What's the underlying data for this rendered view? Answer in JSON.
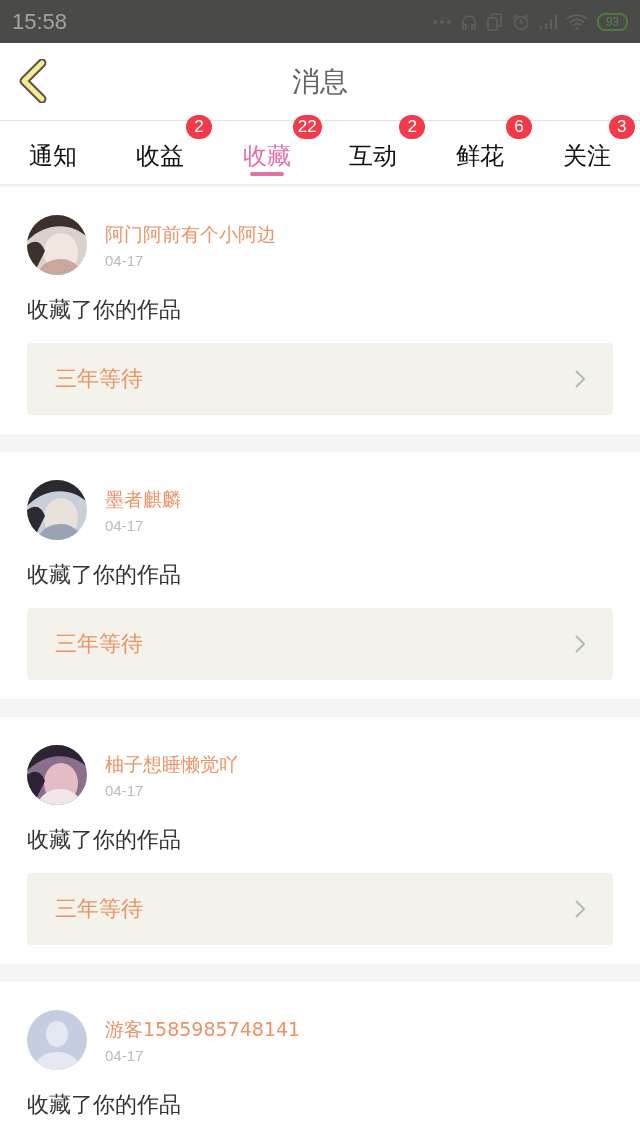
{
  "status_bar": {
    "time": "15:58",
    "battery": "93"
  },
  "header": {
    "title": "消息"
  },
  "tabs": [
    {
      "label": "通知",
      "selected": false
    },
    {
      "label": "收益",
      "selected": false,
      "badge": "2"
    },
    {
      "label": "收藏",
      "selected": true,
      "badge": "22"
    },
    {
      "label": "互动",
      "selected": false,
      "badge": "2"
    },
    {
      "label": "鲜花",
      "selected": false,
      "badge": "6"
    },
    {
      "label": "关注",
      "selected": false,
      "badge": "3"
    }
  ],
  "messages": [
    {
      "kind": "picture",
      "name": "阿门阿前有个小阿边",
      "date": "04-17",
      "text": "收藏了你的作品",
      "work": "三年等待"
    },
    {
      "kind": "picture",
      "name": "墨者麒麟",
      "date": "04-17",
      "text": "收藏了你的作品",
      "work": "三年等待"
    },
    {
      "kind": "picture",
      "name": "柚子想睡懒觉吖",
      "date": "04-17",
      "text": "收藏了你的作品",
      "work": "三年等待"
    },
    {
      "kind": "default",
      "name": "游客1585985748141",
      "date": "04-17",
      "text": "收藏了你的作品"
    }
  ]
}
